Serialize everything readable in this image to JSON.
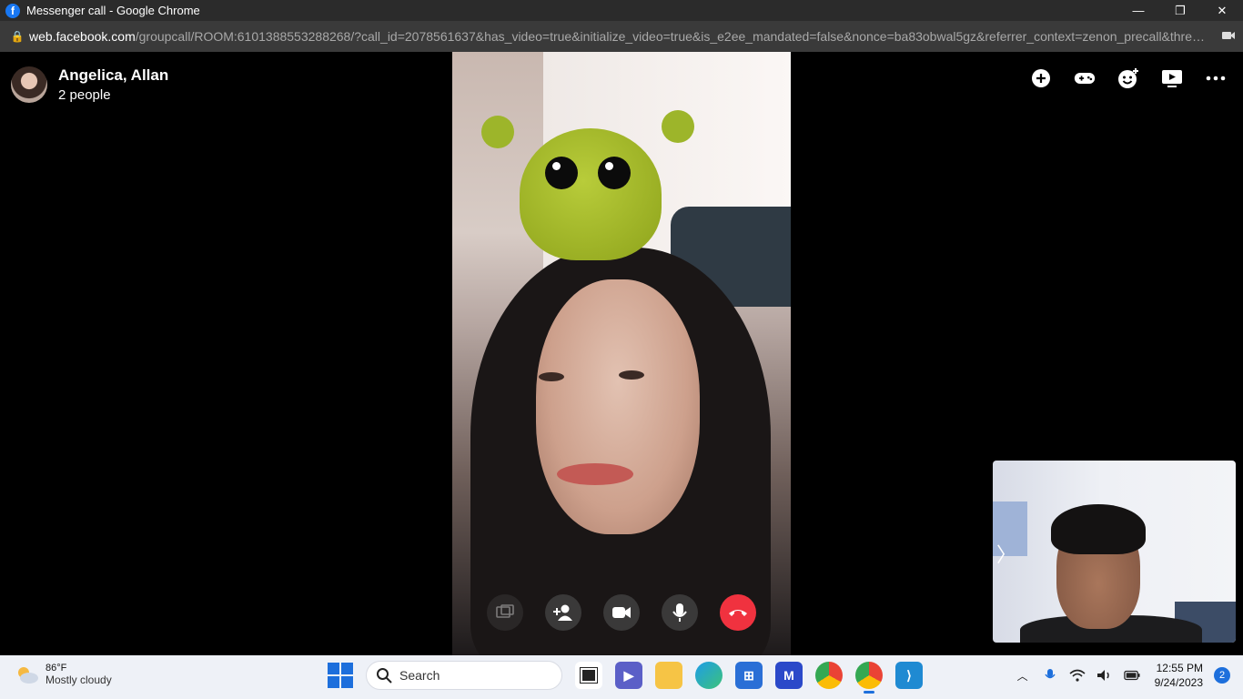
{
  "window": {
    "title": "Messenger call - Google Chrome"
  },
  "address_bar": {
    "host": "web.facebook.com",
    "path": "/groupcall/ROOM:6101388553288268/?call_id=2078561637&has_video=true&initialize_video=true&is_e2ee_mandated=false&nonce=ba83obwal5gz&referrer_context=zenon_precall&threa..."
  },
  "call": {
    "title": "Angelica, Allan",
    "subtitle": "2 people",
    "top_actions": [
      "add-icon",
      "gamepad-icon",
      "emoji-add-icon",
      "share-screen-icon",
      "more-icon"
    ],
    "controls": [
      "share-screen-icon",
      "add-person-icon",
      "video-camera-icon",
      "microphone-icon",
      "end-call-icon"
    ],
    "end_color": "#f0323f"
  },
  "taskbar": {
    "weather_temp": "86°F",
    "weather_desc": "Mostly cloudy",
    "search_placeholder": "Search",
    "apps": [
      "task-view",
      "teams",
      "file-explorer",
      "edge",
      "store",
      "power-automate",
      "chrome",
      "chrome-profile",
      "vscode"
    ],
    "time": "12:55 PM",
    "date": "9/24/2023",
    "notifications": "2",
    "accent": "#1d6fdc"
  }
}
